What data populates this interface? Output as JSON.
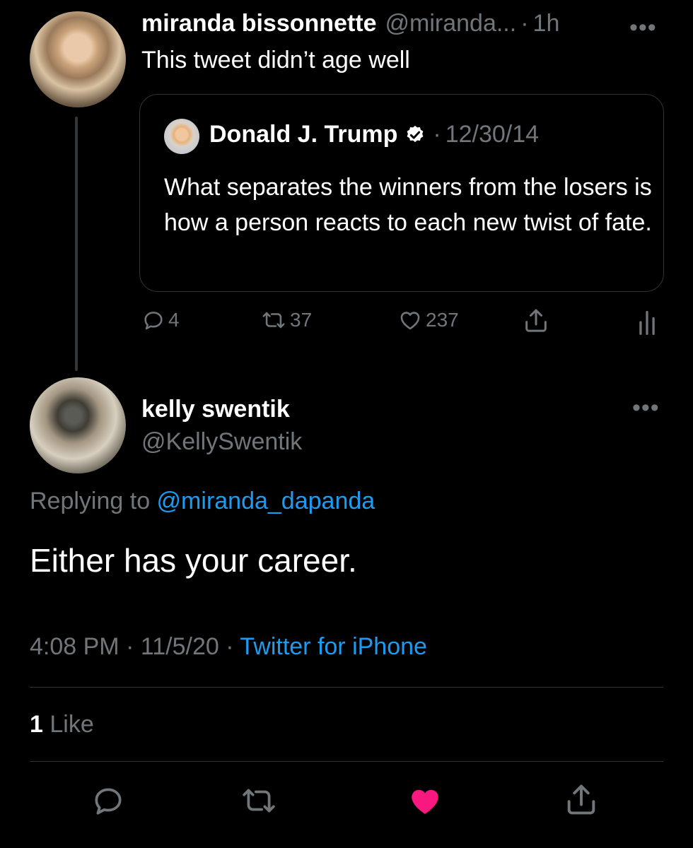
{
  "tweet1": {
    "name": "miranda bissonnette",
    "handle": "@miranda...",
    "dot": "·",
    "time": "1h",
    "more": "•••",
    "text": "This tweet didn’t age well",
    "quote": {
      "name": "Donald J. Trump",
      "dot": "·",
      "date": "12/30/14",
      "text": "What separates the winners from the losers is how a person reacts to each new twist of fate."
    },
    "actions": {
      "replies": "4",
      "retweets": "37",
      "likes": "237"
    }
  },
  "tweet2": {
    "name": "kelly swentik",
    "handle": "@KellySwentik",
    "more": "•••",
    "replying_prefix": "Replying to ",
    "replying_to": "@miranda_dapanda",
    "text": "Either has your career.",
    "time": "4:08 PM",
    "sep1": " · ",
    "date": "11/5/20",
    "sep2": " · ",
    "source": "Twitter for iPhone",
    "like_count": "1",
    "like_label": " Like"
  },
  "colors": {
    "background": "#000000",
    "muted": "#71767b",
    "link": "#1d9bf0",
    "like_active": "#f91880",
    "divider": "#2f3336"
  },
  "icons": {
    "reply": "reply-icon",
    "retweet": "retweet-icon",
    "like": "heart-icon",
    "share": "share-icon",
    "analytics": "analytics-icon",
    "verified": "verified-badge-icon"
  }
}
